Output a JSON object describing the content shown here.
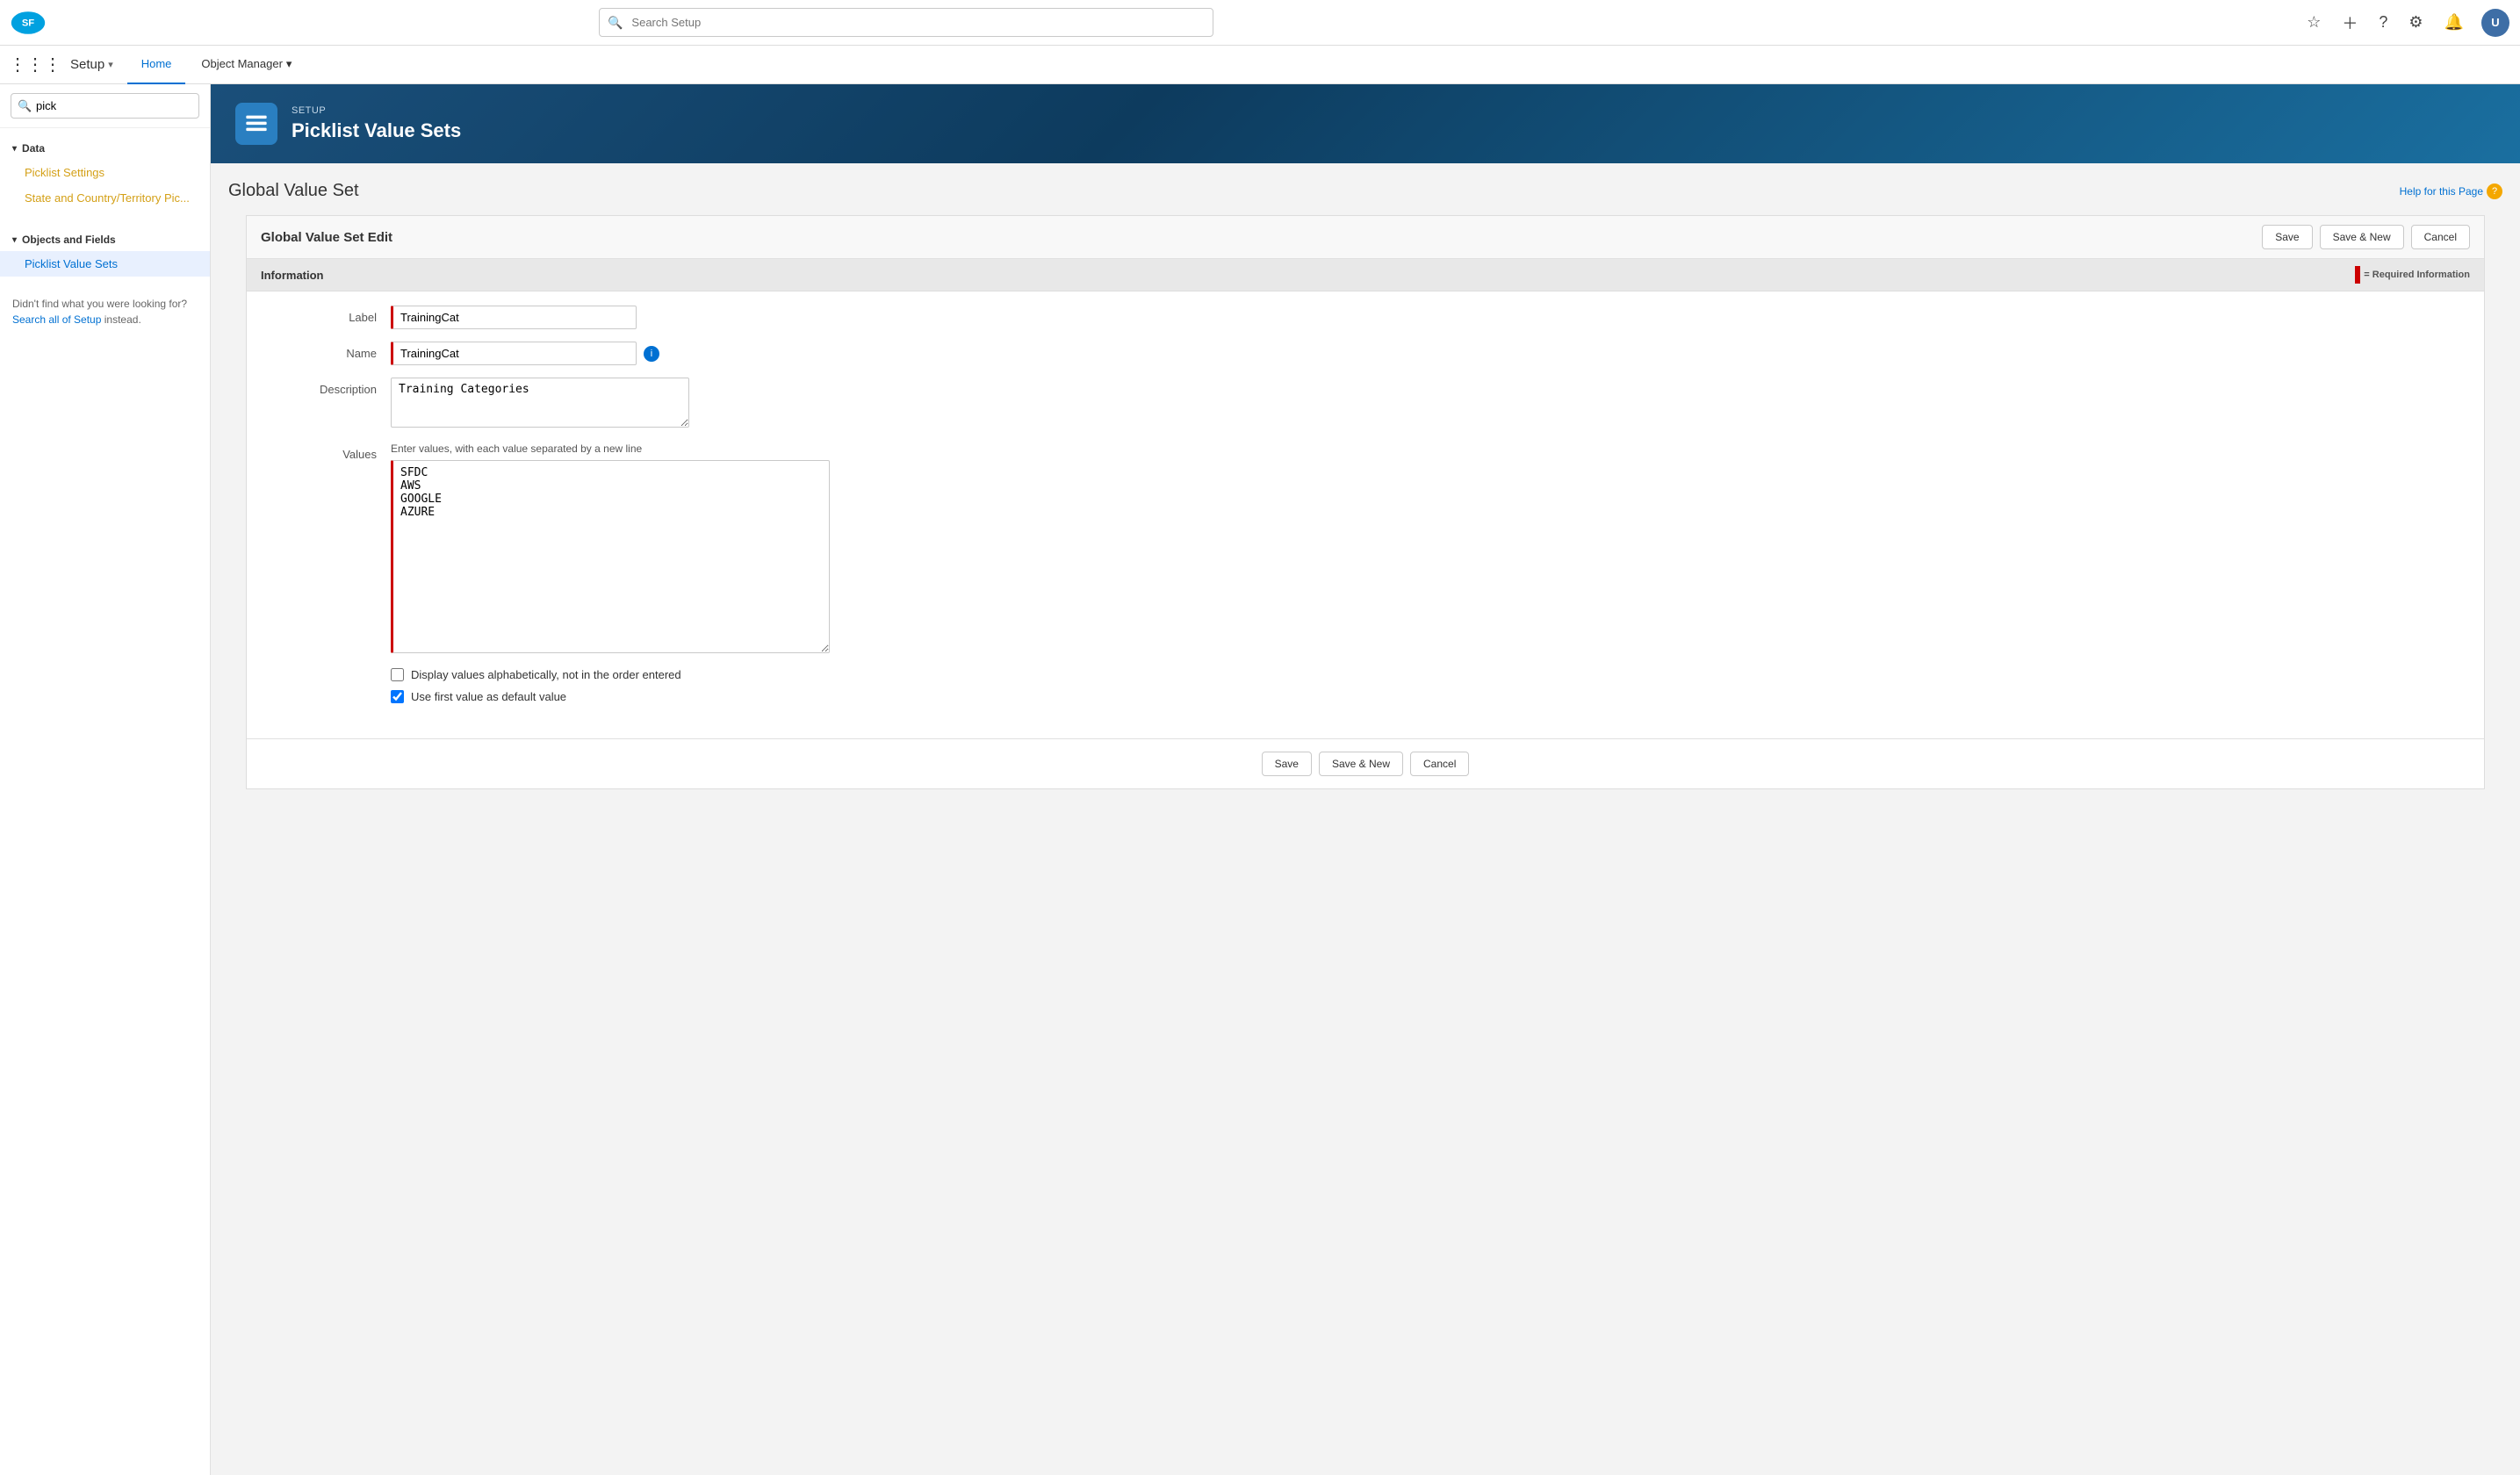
{
  "browser": {
    "url": "https://connect-java-2931-dev-ed.lightning.force.com/one/one.app#/setup/Picklists/page?address=%2F0Nt%2Fe%3FretURL%3D%252F_ui%252Fplatfor..."
  },
  "topbar": {
    "search_placeholder": "Search Setup",
    "logo_alt": "Salesforce"
  },
  "nav": {
    "setup_label": "Setup",
    "tabs": [
      {
        "label": "Home",
        "active": true
      },
      {
        "label": "Object Manager",
        "has_chevron": true
      }
    ]
  },
  "sidebar": {
    "search_value": "pick",
    "search_placeholder": "",
    "sections": [
      {
        "label": "Data",
        "expanded": true,
        "items": [
          {
            "label": "Picklist Settings",
            "highlight": true
          },
          {
            "label": "State and Country/Territory Pic...",
            "highlight": true
          }
        ]
      },
      {
        "label": "Objects and Fields",
        "expanded": true,
        "items": [
          {
            "label": "Picklist Value Sets",
            "active": true
          }
        ]
      }
    ],
    "not_found_text": "Didn't find what you were looking for?",
    "search_all_label": "Search all of Setup",
    "search_all_suffix": " instead."
  },
  "page_header": {
    "setup_label": "SETUP",
    "title": "Picklist Value Sets"
  },
  "global_value_set": {
    "title": "Global Value Set",
    "help_label": "Help for this Page",
    "form_title": "Global Value Set Edit",
    "save_label": "Save",
    "save_new_label": "Save & New",
    "cancel_label": "Cancel",
    "info_section_label": "Information",
    "required_text": "= Required Information",
    "label_field": {
      "label": "Label",
      "value": "TrainingCat"
    },
    "name_field": {
      "label": "Name",
      "value": "TrainingCat"
    },
    "description_field": {
      "label": "Description",
      "value": "Training Categories"
    },
    "values_field": {
      "label": "Values",
      "hint": "Enter values, with each value separated by a new line",
      "value": "SFDC\nAWS\nGOOGLE\nAZURE"
    },
    "checkbox_alpha": {
      "label": "Display values alphabetically, not in the order entered",
      "checked": false
    },
    "checkbox_default": {
      "label": "Use first value as default value",
      "checked": true
    }
  },
  "icons": {
    "search": "🔍",
    "apps_grid": "⋮⋮⋮",
    "chevron_down": "▾",
    "chevron_right": "▸",
    "star": "☆",
    "plus": "+",
    "question": "?",
    "gear": "⚙",
    "bell": "🔔",
    "info": "i",
    "layers": "≡"
  }
}
